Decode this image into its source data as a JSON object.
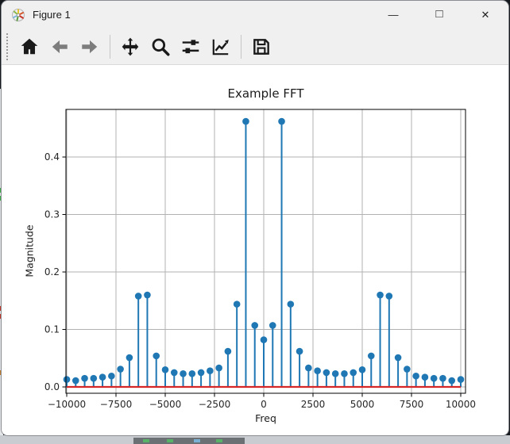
{
  "window": {
    "title": "Figure 1",
    "controls": {
      "minimize": "—",
      "maximize": "□",
      "close": "✕"
    }
  },
  "toolbar": {
    "buttons": [
      "home",
      "back",
      "forward",
      "pan",
      "zoom-to-rect",
      "configure-subplots",
      "edit-parameters",
      "save"
    ]
  },
  "chart_data": {
    "type": "stem",
    "title": "Example FFT",
    "xlabel": "Freq",
    "ylabel": "Magnitude",
    "x_ticks": [
      -10000,
      -7500,
      -5000,
      -2500,
      0,
      2500,
      5000,
      7500,
      10000
    ],
    "x_tick_labels": [
      "−10000",
      "−7500",
      "−5000",
      "−2500",
      "0",
      "2500",
      "5000",
      "7500",
      "10000"
    ],
    "y_ticks": [
      0.0,
      0.1,
      0.2,
      0.3,
      0.4
    ],
    "y_tick_labels": [
      "0.0",
      "0.1",
      "0.2",
      "0.3",
      "0.4"
    ],
    "xlim": [
      -10040,
      10242
    ],
    "ylim": [
      -0.011,
      0.4828
    ],
    "grid": true,
    "x_start": -10000,
    "x_end": 10000,
    "n_points": 45,
    "values": [
      0.013,
      0.011,
      0.015,
      0.015,
      0.017,
      0.019,
      0.031,
      0.051,
      0.158,
      0.16,
      0.054,
      0.03,
      0.025,
      0.023,
      0.023,
      0.025,
      0.028,
      0.033,
      0.062,
      0.144,
      0.462,
      0.107,
      0.082,
      0.107,
      0.462,
      0.144,
      0.062,
      0.033,
      0.028,
      0.025,
      0.023,
      0.023,
      0.025,
      0.03,
      0.054,
      0.16,
      0.158,
      0.051,
      0.031,
      0.019,
      0.017,
      0.015,
      0.015,
      0.011,
      0.013
    ],
    "stem_color": "#1f77b4",
    "marker_color": "#1f77b4",
    "baseline": {
      "y": 0.0,
      "color": "#d62728"
    },
    "grid_color": "#b2b2b2",
    "spine_color": "#000000",
    "tick_label_color": "#262626"
  }
}
